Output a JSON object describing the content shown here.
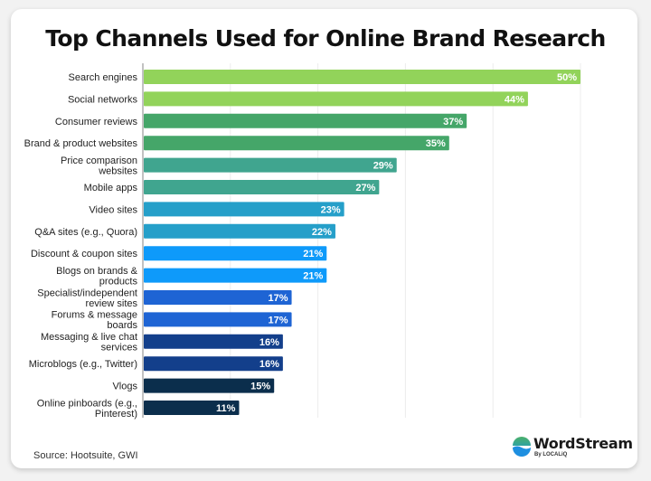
{
  "chart_data": {
    "type": "bar",
    "orientation": "horizontal",
    "title": "Top Channels Used for Online Brand Research",
    "xlabel": "",
    "ylabel": "",
    "xlim": [
      0,
      50
    ],
    "grid": true,
    "value_suffix": "%",
    "categories": [
      "Search engines",
      "Social networks",
      "Consumer reviews",
      "Brand & product websites",
      "Price comparison websites",
      "Mobile apps",
      "Video sites",
      "Q&A sites (e.g., Quora)",
      "Discount & coupon sites",
      "Blogs on brands & products",
      "Specialist/independent review sites",
      "Forums & message boards",
      "Messaging & live chat services",
      "Microblogs (e.g., Twitter)",
      "Vlogs",
      "Online pinboards (e.g., Pinterest)"
    ],
    "label_lines": [
      [
        "Search engines"
      ],
      [
        "Social networks"
      ],
      [
        "Consumer reviews"
      ],
      [
        "Brand & product websites"
      ],
      [
        "Price comparison",
        "websites"
      ],
      [
        "Mobile apps"
      ],
      [
        "Video sites"
      ],
      [
        "Q&A sites (e.g., Quora)"
      ],
      [
        "Discount & coupon sites"
      ],
      [
        "Blogs on brands &",
        "products"
      ],
      [
        "Specialist/independent",
        "review sites"
      ],
      [
        "Forums & message",
        "boards"
      ],
      [
        "Messaging & live chat",
        "services"
      ],
      [
        "Microblogs (e.g., Twitter)"
      ],
      [
        "Vlogs"
      ],
      [
        "Online pinboards (e.g.,",
        "Pinterest)"
      ]
    ],
    "values": [
      50,
      44,
      37,
      35,
      29,
      27,
      23,
      22,
      21,
      21,
      17,
      17,
      16,
      16,
      15,
      11
    ],
    "data_labels": [
      "50%",
      "44%",
      "37%",
      "35%",
      "29%",
      "27%",
      "23%",
      "22%",
      "21%",
      "21%",
      "17%",
      "17%",
      "16%",
      "16%",
      "15%",
      "11%"
    ],
    "colors": [
      "#92d35a",
      "#92d35a",
      "#45a669",
      "#45a669",
      "#40a58f",
      "#40a58f",
      "#259fc9",
      "#259fc9",
      "#0e9afa",
      "#0e9afa",
      "#1e64d4",
      "#1e64d4",
      "#133f8b",
      "#133f8b",
      "#0b2e4c",
      "#0b2e4c"
    ],
    "gridline_values": [
      0,
      10,
      20,
      30,
      40,
      50
    ]
  },
  "footer": {
    "source": "Source: Hootsuite, GWI",
    "brand": "WordStream",
    "brand_sub": "By LOCALiQ"
  }
}
